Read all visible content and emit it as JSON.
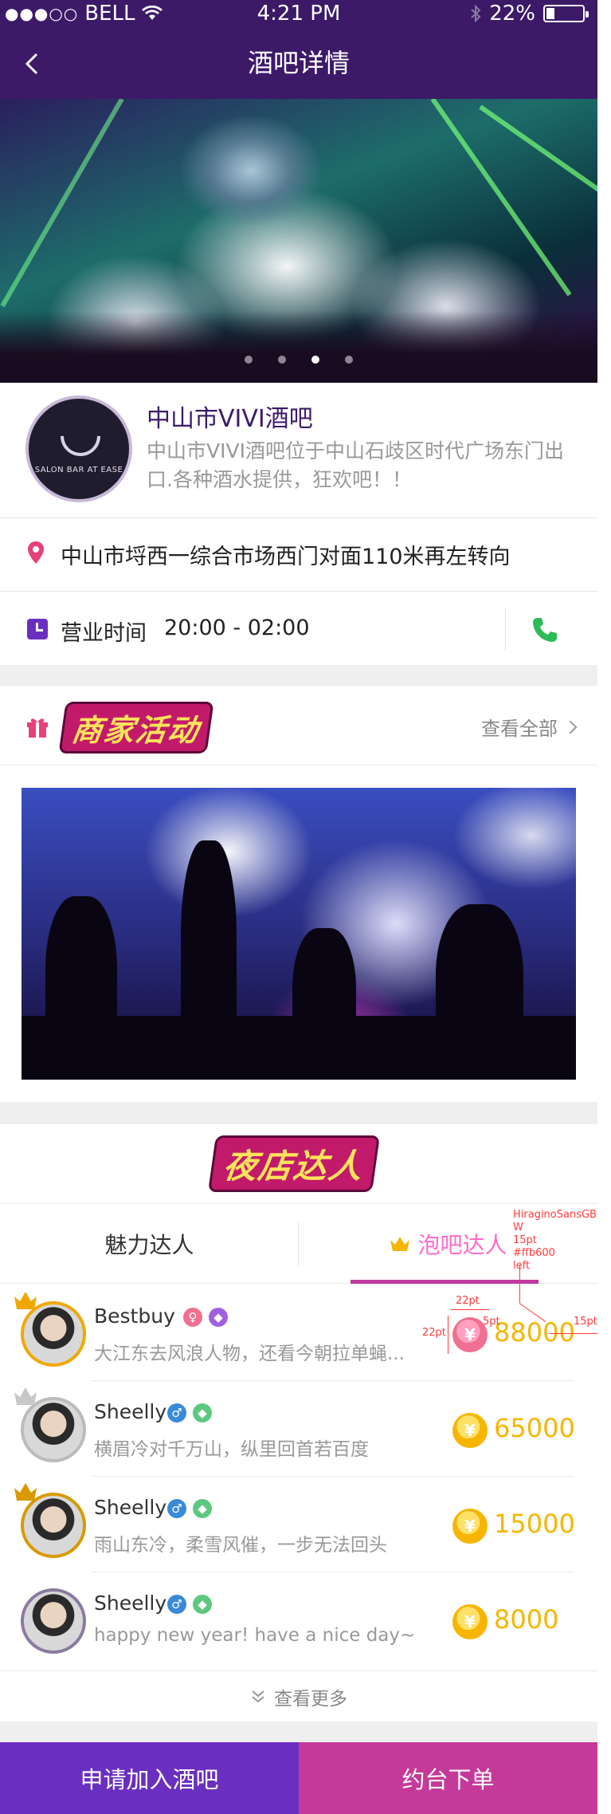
{
  "status_bar": {
    "signal": "●●●○○",
    "carrier": "BELL",
    "time": "4:21 PM",
    "battery": "22%",
    "battery_level": 0.22
  },
  "nav": {
    "title": "酒吧详情"
  },
  "hero": {
    "page_count": 4,
    "active_page": 2
  },
  "bar": {
    "name": "中山市VIVI酒吧",
    "description": "中山市VIVI酒吧位于中山石歧区时代广场东门出口.各种酒水提供，狂欢吧！！",
    "logo_text": "SALON BAR AT EASE",
    "address": "中山市埒西一综合市场西门对面110米再左转向",
    "hours_label": "营业时间",
    "hours_value": "20:00 - 02:00"
  },
  "activities": {
    "title": "商家活动",
    "see_all": "查看全部"
  },
  "talent": {
    "title": "夜店达人",
    "tabs": [
      {
        "label": "魅力达人"
      },
      {
        "label": "泡吧达人",
        "active": true
      }
    ],
    "items": [
      {
        "name": "Bestbuy",
        "bio": "大江东去风浪人物，还看今朝拉单蝇...",
        "amount": "88000",
        "rank": "gold",
        "gender": "female"
      },
      {
        "name": "Sheelly",
        "bio": "横眉冷对千万山，纵里回首若百度",
        "amount": "65000",
        "rank": "silver",
        "gender": "male"
      },
      {
        "name": "Sheelly",
        "bio": "雨山东冷，柔雪风催，一步无法回头",
        "amount": "15000",
        "rank": "bronze",
        "gender": "male"
      },
      {
        "name": "Sheelly",
        "bio": "happy new year! have a nice day~",
        "amount": "8000",
        "rank": "none",
        "gender": "male"
      }
    ],
    "more": "查看更多"
  },
  "annotations": {
    "font_note": "HiraginoSansGB-W",
    "size_note": "15pt",
    "color_note": "#ffb600",
    "align_note": "left",
    "dim_22a": "22pt",
    "dim_22b": "22pt",
    "dim_5": "5pt",
    "dim_15": "15pt"
  },
  "actions": {
    "join": "申请加入酒吧",
    "book": "约台下单"
  },
  "colors": {
    "nav_bg": "#3c1a68",
    "accent_purple": "#6a2fc0",
    "accent_pink": "#c53a99",
    "gold": "#f7b500",
    "tab_active": "#ff6cc8"
  }
}
